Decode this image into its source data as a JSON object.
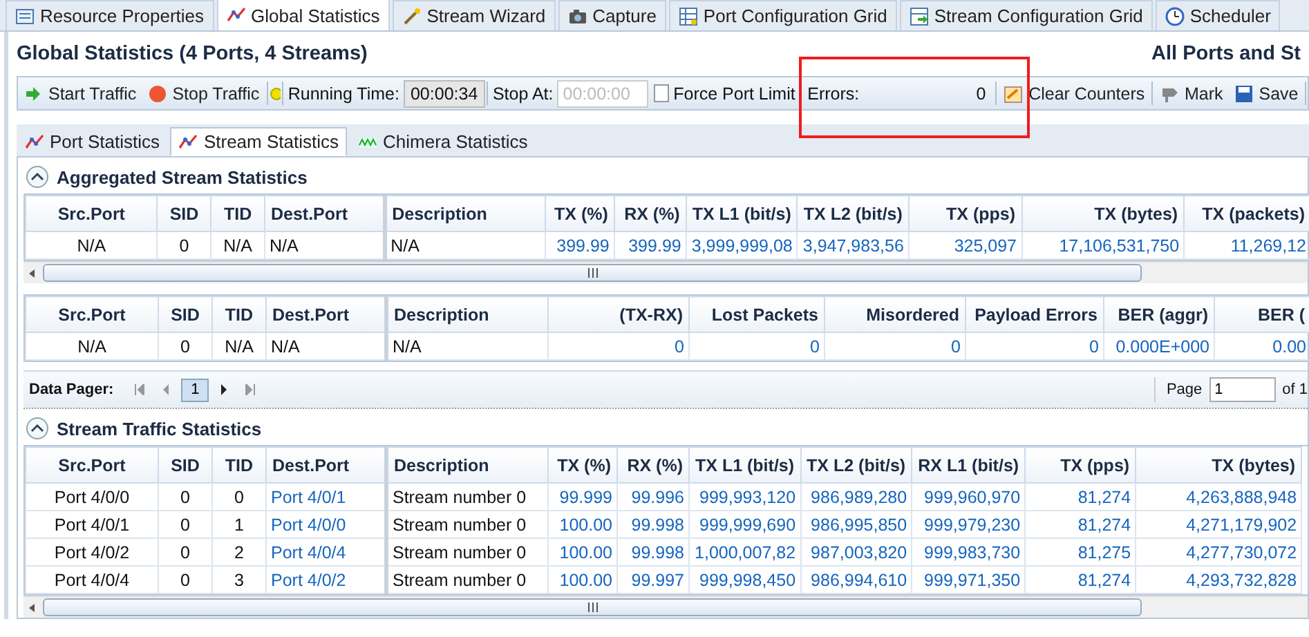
{
  "top_tabs": [
    {
      "label": "Resource Properties",
      "selected": false
    },
    {
      "label": "Global Statistics",
      "selected": true
    },
    {
      "label": "Stream Wizard",
      "selected": false
    },
    {
      "label": "Capture",
      "selected": false
    },
    {
      "label": "Port Configuration Grid",
      "selected": false
    },
    {
      "label": "Stream Configuration Grid",
      "selected": false
    },
    {
      "label": "Scheduler",
      "selected": false
    }
  ],
  "header": {
    "title": "Global Statistics (4 Ports, 4 Streams)",
    "scope": "All Ports and St"
  },
  "toolbar": {
    "start": "Start Traffic",
    "stop": "Stop Traffic",
    "running_label": "Running Time:",
    "running_time": "00:00:34",
    "stop_at_label": "Stop At:",
    "stop_at_placeholder": "00:00:00",
    "force_port_limit": {
      "label": "Force Port Limit",
      "checked": false
    },
    "errors_label": "Errors:",
    "errors_value": "0",
    "clear": "Clear Counters",
    "mark": "Mark",
    "save": "Save"
  },
  "sub_tabs": [
    {
      "label": "Port Statistics",
      "selected": false
    },
    {
      "label": "Stream Statistics",
      "selected": true
    },
    {
      "label": "Chimera Statistics",
      "selected": false
    }
  ],
  "aggregated": {
    "title": "Aggregated Stream Statistics",
    "expanded": true,
    "tables": [
      {
        "columns": [
          {
            "label": "Src.Port",
            "kind": "center"
          },
          {
            "label": "SID",
            "kind": "center"
          },
          {
            "label": "TID",
            "kind": "center"
          },
          {
            "label": "Dest.Port",
            "kind": "text"
          },
          {
            "label": "Description",
            "kind": "text"
          },
          {
            "label": "TX (%)",
            "kind": "num"
          },
          {
            "label": "RX (%)",
            "kind": "num"
          },
          {
            "label": "TX L1 (bit/s)",
            "kind": "num"
          },
          {
            "label": "TX L2 (bit/s)",
            "kind": "num"
          },
          {
            "label": "TX (pps)",
            "kind": "num"
          },
          {
            "label": "TX (bytes)",
            "kind": "num"
          },
          {
            "label": "TX (packets)",
            "kind": "num"
          }
        ],
        "rows": [
          [
            "N/A",
            "0",
            "N/A",
            "N/A",
            "N/A",
            "399.99",
            "399.99",
            "3,999,999,08",
            "3,947,983,56",
            "325,097",
            "17,106,531,750",
            "11,269,12"
          ]
        ]
      },
      {
        "columns": [
          {
            "label": "Src.Port",
            "kind": "center"
          },
          {
            "label": "SID",
            "kind": "center"
          },
          {
            "label": "TID",
            "kind": "center"
          },
          {
            "label": "Dest.Port",
            "kind": "text"
          },
          {
            "label": "Description",
            "kind": "text"
          },
          {
            "label": "(TX-RX)",
            "kind": "num"
          },
          {
            "label": "Lost Packets",
            "kind": "num"
          },
          {
            "label": "Misordered",
            "kind": "num"
          },
          {
            "label": "Payload Errors",
            "kind": "num"
          },
          {
            "label": "BER (aggr)",
            "kind": "num"
          },
          {
            "label": "BER (",
            "kind": "num"
          }
        ],
        "rows": [
          [
            "N/A",
            "0",
            "N/A",
            "N/A",
            "N/A",
            "0",
            "0",
            "0",
            "0",
            "0.000E+000",
            "0.00"
          ]
        ]
      }
    ]
  },
  "pager": {
    "label": "Data Pager:",
    "current": "1",
    "page_label": "Page",
    "page_value": "1",
    "of": "of 1"
  },
  "stream_traffic": {
    "title": "Stream Traffic Statistics",
    "expanded": true,
    "columns": [
      {
        "label": "Src.Port",
        "kind": "center"
      },
      {
        "label": "SID",
        "kind": "center"
      },
      {
        "label": "TID",
        "kind": "center"
      },
      {
        "label": "Dest.Port",
        "kind": "link"
      },
      {
        "label": "Description",
        "kind": "text"
      },
      {
        "label": "TX (%)",
        "kind": "num"
      },
      {
        "label": "RX (%)",
        "kind": "num"
      },
      {
        "label": "TX L1 (bit/s)",
        "kind": "num"
      },
      {
        "label": "TX L2 (bit/s)",
        "kind": "num"
      },
      {
        "label": "RX L1 (bit/s)",
        "kind": "num"
      },
      {
        "label": "TX (pps)",
        "kind": "num"
      },
      {
        "label": "TX (bytes)",
        "kind": "num"
      }
    ],
    "rows": [
      [
        "Port 4/0/0",
        "0",
        "0",
        "Port 4/0/1",
        "Stream number 0",
        "99.999",
        "99.996",
        "999,993,120",
        "986,989,280",
        "999,960,970",
        "81,274",
        "4,263,888,948"
      ],
      [
        "Port 4/0/1",
        "0",
        "1",
        "Port 4/0/0",
        "Stream number 0",
        "100.00",
        "99.998",
        "999,999,690",
        "986,995,850",
        "999,979,230",
        "81,274",
        "4,271,179,902"
      ],
      [
        "Port 4/0/2",
        "0",
        "2",
        "Port 4/0/4",
        "Stream number 0",
        "100.00",
        "99.998",
        "1,000,007,82",
        "987,003,820",
        "999,983,730",
        "81,275",
        "4,277,730,072"
      ],
      [
        "Port 4/0/4",
        "0",
        "3",
        "Port 4/0/2",
        "Stream number 0",
        "100.00",
        "99.997",
        "999,998,450",
        "986,994,610",
        "999,971,350",
        "81,274",
        "4,293,732,828"
      ]
    ]
  }
}
